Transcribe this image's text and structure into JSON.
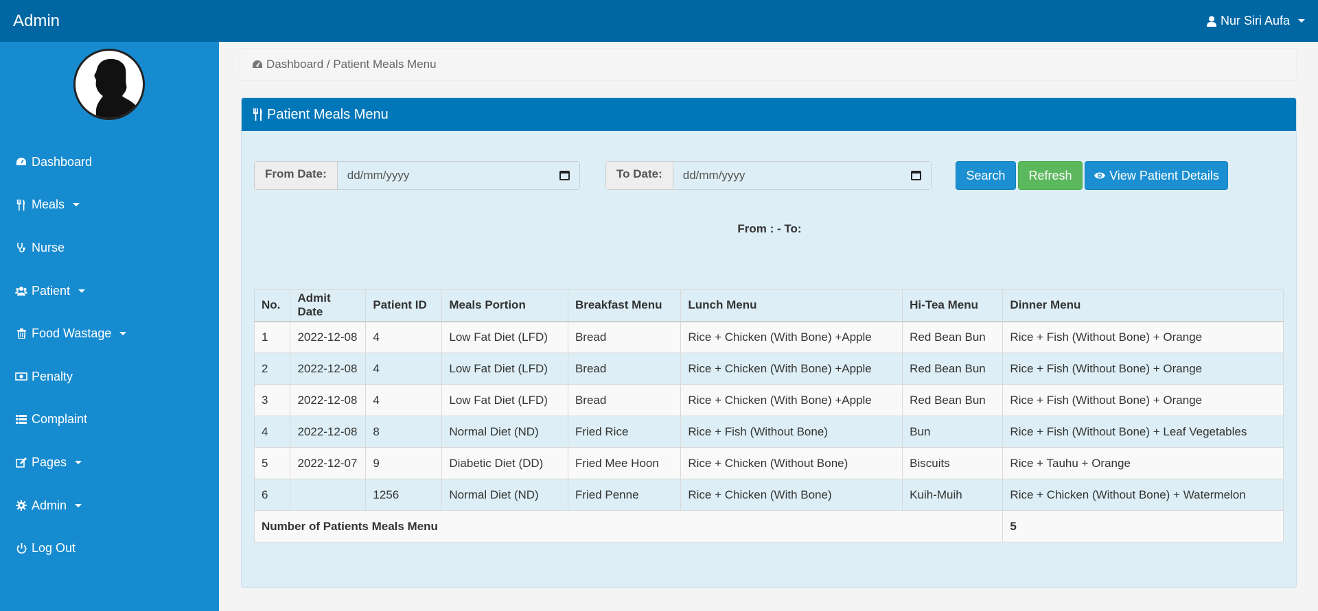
{
  "topbar": {
    "brand": "Admin",
    "user": "Nur Siri Aufa"
  },
  "sidebar": {
    "items": [
      {
        "label": "Dashboard",
        "icon": "dashboard-icon",
        "dropdown": false
      },
      {
        "label": "Meals",
        "icon": "cutlery-icon",
        "dropdown": true
      },
      {
        "label": "Nurse",
        "icon": "stethoscope-icon",
        "dropdown": false
      },
      {
        "label": "Patient",
        "icon": "users-icon",
        "dropdown": true
      },
      {
        "label": "Food Wastage",
        "icon": "trash-icon",
        "dropdown": true
      },
      {
        "label": "Penalty",
        "icon": "money-icon",
        "dropdown": false
      },
      {
        "label": "Complaint",
        "icon": "list-icon",
        "dropdown": false
      },
      {
        "label": "Pages",
        "icon": "edit-icon",
        "dropdown": true
      },
      {
        "label": "Admin",
        "icon": "gear-icon",
        "dropdown": true
      },
      {
        "label": "Log Out",
        "icon": "power-icon",
        "dropdown": false
      }
    ]
  },
  "breadcrumb": {
    "text": "Dashboard / Patient Meals Menu"
  },
  "panel": {
    "title": "Patient Meals Menu"
  },
  "filters": {
    "from_label": "From Date:",
    "from_placeholder": "dd/mm/yyyy",
    "to_label": "To Date:",
    "to_placeholder": "dd/mm/yyyy",
    "search": "Search",
    "refresh": "Refresh",
    "view": "View Patient Details"
  },
  "range_text": "From : - To:",
  "table": {
    "headers": [
      "No.",
      "Admit Date",
      "Patient ID",
      "Meals Portion",
      "Breakfast Menu",
      "Lunch Menu",
      "Hi-Tea Menu",
      "Dinner Menu"
    ],
    "rows": [
      [
        "1",
        "2022-12-08",
        "4",
        "Low Fat Diet (LFD)",
        "Bread",
        "Rice + Chicken (With Bone) +Apple",
        "Red Bean Bun",
        "Rice + Fish (Without Bone) + Orange"
      ],
      [
        "2",
        "2022-12-08",
        "4",
        "Low Fat Diet (LFD)",
        "Bread",
        "Rice + Chicken (With Bone) +Apple",
        "Red Bean Bun",
        "Rice + Fish (Without Bone) + Orange"
      ],
      [
        "3",
        "2022-12-08",
        "4",
        "Low Fat Diet (LFD)",
        "Bread",
        "Rice + Chicken (With Bone) +Apple",
        "Red Bean Bun",
        "Rice + Fish (Without Bone) + Orange"
      ],
      [
        "4",
        "2022-12-08",
        "8",
        "Normal Diet (ND)",
        "Fried Rice",
        "Rice + Fish (Without Bone)",
        "Bun",
        "Rice + Fish (Without Bone) + Leaf Vegetables"
      ],
      [
        "5",
        "2022-12-07",
        "9",
        "Diabetic Diet (DD)",
        "Fried Mee Hoon",
        "Rice + Chicken (Without Bone)",
        "Biscuits",
        "Rice + Tauhu + Orange"
      ],
      [
        "6",
        "",
        "1256",
        "Normal Diet (ND)",
        "Fried Penne",
        "Rice + Chicken (With Bone)",
        "Kuih-Muih",
        "Rice + Chicken (Without Bone) + Watermelon"
      ]
    ],
    "total_label": "Number of Patients Meals Menu",
    "total_value": "5"
  }
}
